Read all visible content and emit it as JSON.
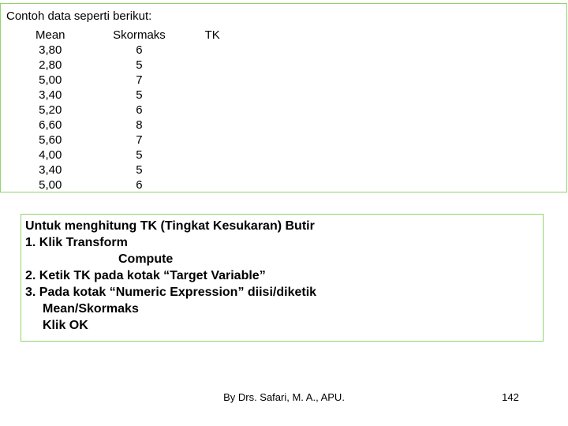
{
  "slide": {
    "page_number": "142",
    "accent_color": "#92d36e"
  },
  "data_panel": {
    "title": "Contoh data seperti berikut:",
    "table": {
      "headers": [
        "Mean",
        "Skormaks",
        "TK"
      ],
      "rows": [
        {
          "mean": "3,80",
          "skormaks": "6",
          "tk": ""
        },
        {
          "mean": "2,80",
          "skormaks": "5",
          "tk": ""
        },
        {
          "mean": "5,00",
          "skormaks": "7",
          "tk": ""
        },
        {
          "mean": "3,40",
          "skormaks": "5",
          "tk": ""
        },
        {
          "mean": "5,20",
          "skormaks": "6",
          "tk": ""
        },
        {
          "mean": "6,60",
          "skormaks": "8",
          "tk": ""
        },
        {
          "mean": "5,60",
          "skormaks": "7",
          "tk": ""
        },
        {
          "mean": "4,00",
          "skormaks": "5",
          "tk": ""
        },
        {
          "mean": "3,40",
          "skormaks": "5",
          "tk": ""
        },
        {
          "mean": "5,00",
          "skormaks": "6",
          "tk": ""
        }
      ]
    }
  },
  "steps_panel": {
    "heading": "Untuk menghitung TK (Tingkat Kesukaran) Butir",
    "lines": [
      "1. Klik Transform",
      "Compute",
      "2. Ketik TK pada kotak “Target Variable”",
      "3. Pada kotak “Numeric Expression” diisi/diketik",
      "Mean/Skormaks",
      "Klik OK"
    ]
  },
  "footer": {
    "author": "By Drs. Safari, M. A., APU.",
    "page": "142"
  }
}
